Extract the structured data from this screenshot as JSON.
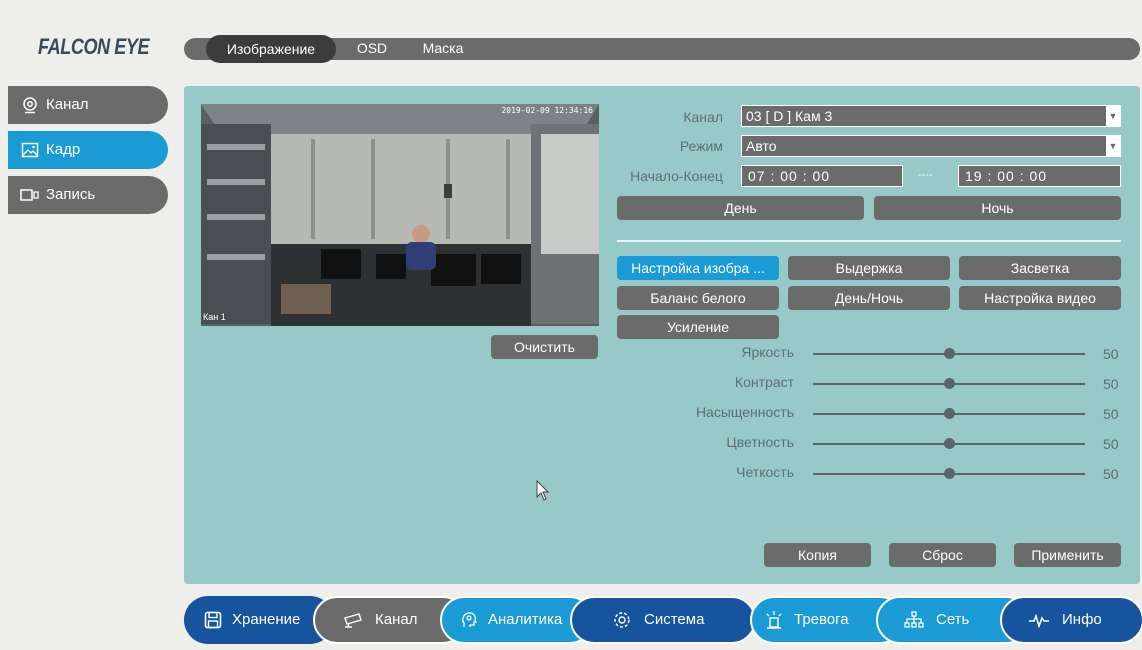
{
  "logo": "FALCON EYE",
  "top_tabs": [
    {
      "label": "Изображение",
      "active": true
    },
    {
      "label": "OSD",
      "active": false
    },
    {
      "label": "Маска",
      "active": false
    }
  ],
  "sidebar": {
    "items": [
      {
        "label": "Канал",
        "icon": "webcam-icon",
        "active": false
      },
      {
        "label": "Кадр",
        "icon": "image-icon",
        "active": true
      },
      {
        "label": "Запись",
        "icon": "record-camera-icon",
        "active": false
      }
    ]
  },
  "preview": {
    "timestamp": "2019-02-09 12:34:16",
    "camera_label": "Кан 1",
    "clear_label": "Очистить"
  },
  "form": {
    "channel_label": "Канал",
    "channel_value": "03 [ D ] Кам 3",
    "mode_label": "Режим",
    "mode_value": "Авто",
    "startend_label": "Начало-Конец",
    "start_time": "07 : 00 : 00",
    "range_sep": "----",
    "end_time": "19 : 00 : 00",
    "day_label": "День",
    "night_label": "Ночь"
  },
  "settings_buttons": [
    {
      "label": "Настройка изобра ...",
      "active": true
    },
    {
      "label": "Выдержка",
      "active": false
    },
    {
      "label": "Засветка",
      "active": false
    },
    {
      "label": "Баланс белого",
      "active": false
    },
    {
      "label": "День/Ночь",
      "active": false
    },
    {
      "label": "Настройка видео",
      "active": false
    },
    {
      "label": "Усиление",
      "active": false
    }
  ],
  "sliders": [
    {
      "label": "Яркость",
      "value": 50,
      "max": 100
    },
    {
      "label": "Контраст",
      "value": 50,
      "max": 100
    },
    {
      "label": "Насыщенность",
      "value": 50,
      "max": 100
    },
    {
      "label": "Цветность",
      "value": 50,
      "max": 100
    },
    {
      "label": "Четкость",
      "value": 50,
      "max": 100
    }
  ],
  "actions": {
    "copy": "Копия",
    "reset": "Сброс",
    "apply": "Применить"
  },
  "bottom_nav": [
    {
      "label": "Хранение",
      "icon": "save-icon",
      "color": "#16549e"
    },
    {
      "label": "Канал",
      "icon": "camera-icon",
      "color": "#6b6b6b"
    },
    {
      "label": "Аналитика",
      "icon": "analytics-head-icon",
      "color": "#1a9bd6"
    },
    {
      "label": "Система",
      "icon": "gear-icon",
      "color": "#16549e"
    },
    {
      "label": "Тревога",
      "icon": "alarm-icon",
      "color": "#1a9bd6"
    },
    {
      "label": "Сеть",
      "icon": "network-icon",
      "color": "#1a9bd6"
    },
    {
      "label": "Инфо",
      "icon": "pulse-icon",
      "color": "#16549e"
    }
  ],
  "colors": {
    "accent_blue": "#1a9bd6",
    "dark_blue": "#16549e",
    "panel_teal": "#97c9c9",
    "gray": "#6b6b6b"
  }
}
